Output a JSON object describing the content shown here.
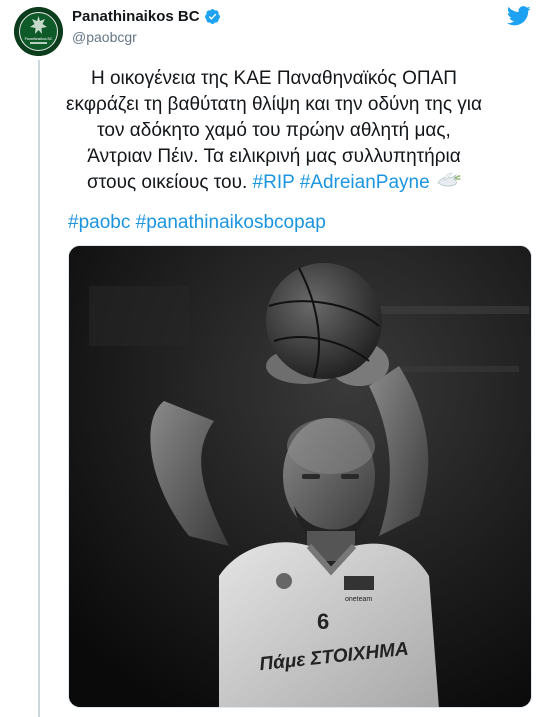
{
  "author": {
    "display_name": "Panathinaikos BC",
    "handle": "@paobcgr",
    "verified": true,
    "avatar_icon": "panathinaikos-logo",
    "avatar_text": "Panathinaikos BC"
  },
  "platform_icon": "twitter-bird-icon",
  "tweet": {
    "lines": [
      "Η οικογένεια της ΚΑΕ Παναθηναϊκός ΟΠΑΠ",
      "εκφράζει τη βαθύτατη θλίψη και την οδύνη της για",
      "τον αδόκητο χαμό του πρώην αθλητή μας,",
      "Άντριαν Πέιν. Τα ειλικρινή μας συλλυπητήρια"
    ],
    "last_line_text": "στους οικείους του.",
    "inline_hashtags": [
      "#RIP",
      "#AdreianPayne"
    ],
    "emoji": "dove-icon",
    "footer_hashtags": [
      "#paobc",
      "#panathinaikosbcopap"
    ]
  },
  "media": {
    "type": "photo",
    "description_icon": "basketball-player-photo",
    "jersey_number": "6",
    "jersey_sponsor": "cosmote",
    "jersey_slogan": "Πάμε ΣΤΟΙΧΗΜΑ",
    "jersey_patch": "oneteam"
  },
  "colors": {
    "link": "#1b95e0",
    "text": "#14171a",
    "muted": "#657786",
    "verified": "#1da1f2",
    "avatar_bg": "#0b3d1c"
  }
}
